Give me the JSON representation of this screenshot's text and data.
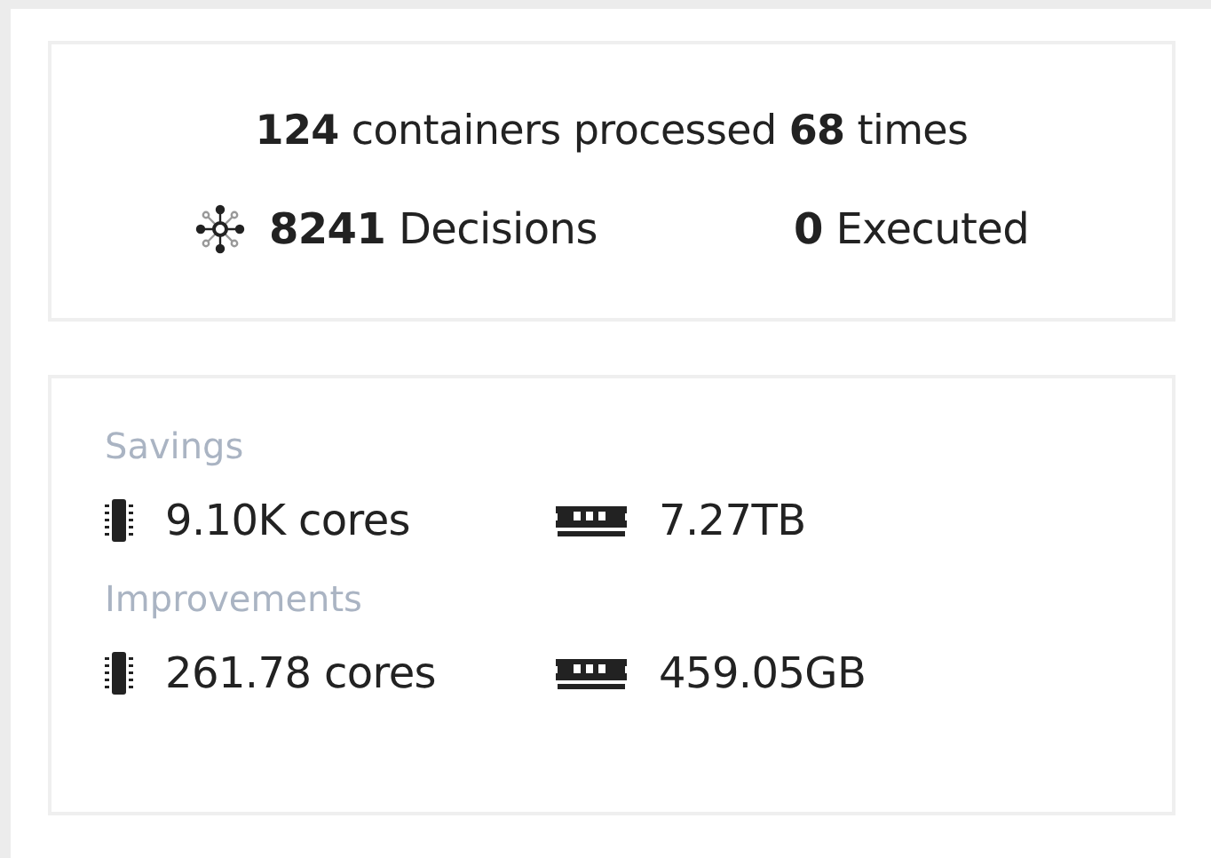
{
  "summary": {
    "headline": "**124** containers processed **68** times",
    "decisions": "**8241** Decisions",
    "executed": "**0** Executed"
  },
  "sections": [
    {
      "title": "Savings",
      "items": [
        {
          "kind": "cpu",
          "value": "9.10K cores"
        },
        {
          "kind": "memory",
          "value": "7.27TB"
        }
      ]
    },
    {
      "title": "Improvements",
      "items": [
        {
          "kind": "cpu",
          "value": "261.78 cores"
        },
        {
          "kind": "memory",
          "value": "459.05GB"
        }
      ]
    }
  ]
}
